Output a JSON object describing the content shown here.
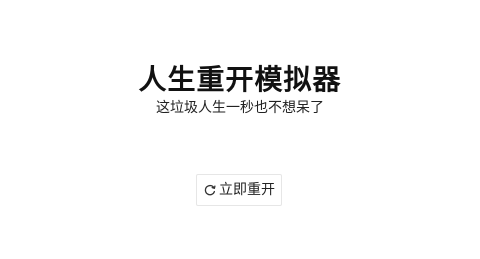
{
  "main": {
    "title": "人生重开模拟器",
    "subtitle": "这垃圾人生一秒也不想呆了",
    "restart_button": {
      "icon": "refresh-icon",
      "label": "立即重开"
    }
  }
}
